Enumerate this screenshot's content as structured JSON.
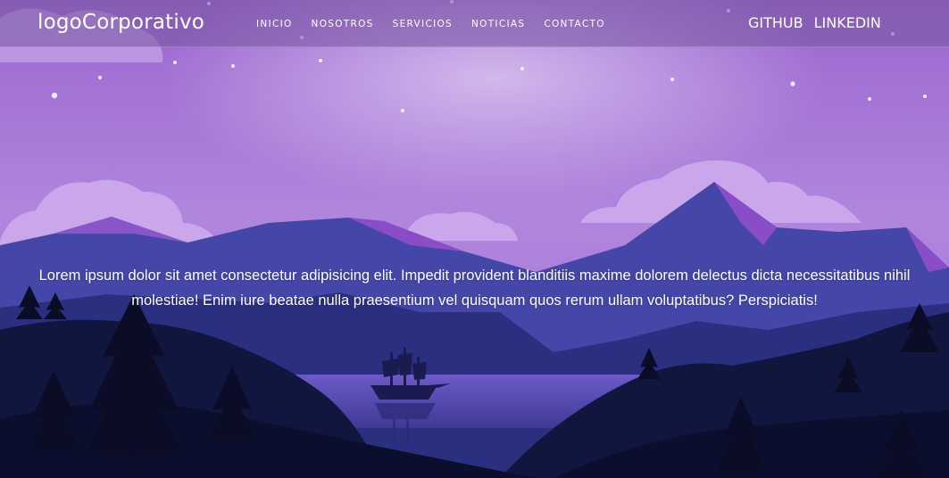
{
  "brand": {
    "logo": "logoCorporativo"
  },
  "nav": {
    "items": [
      {
        "label": "INICIO"
      },
      {
        "label": "NOSOTROS"
      },
      {
        "label": "SERVICIOS"
      },
      {
        "label": "NOTICIAS"
      },
      {
        "label": "CONTACTO"
      }
    ]
  },
  "social": {
    "github": "GITHUB",
    "linkedin": "LINKEDIN"
  },
  "hero": {
    "text": "Lorem ipsum dolor sit amet consectetur adipisicing elit. Impedit provident blanditiis maxime dolorem delectus dicta necessitatibus nihil molestiae! Enim iure beatae nulla praesentium vel quisquam quos rerum ullam voluptatibus? Perspiciatis!",
    "illustration": "purple mountain landscape at night with lake and ship",
    "colors": {
      "sky": "#a877d8",
      "mountain": "#3b3f9c",
      "foreground": "#0d1333"
    }
  }
}
